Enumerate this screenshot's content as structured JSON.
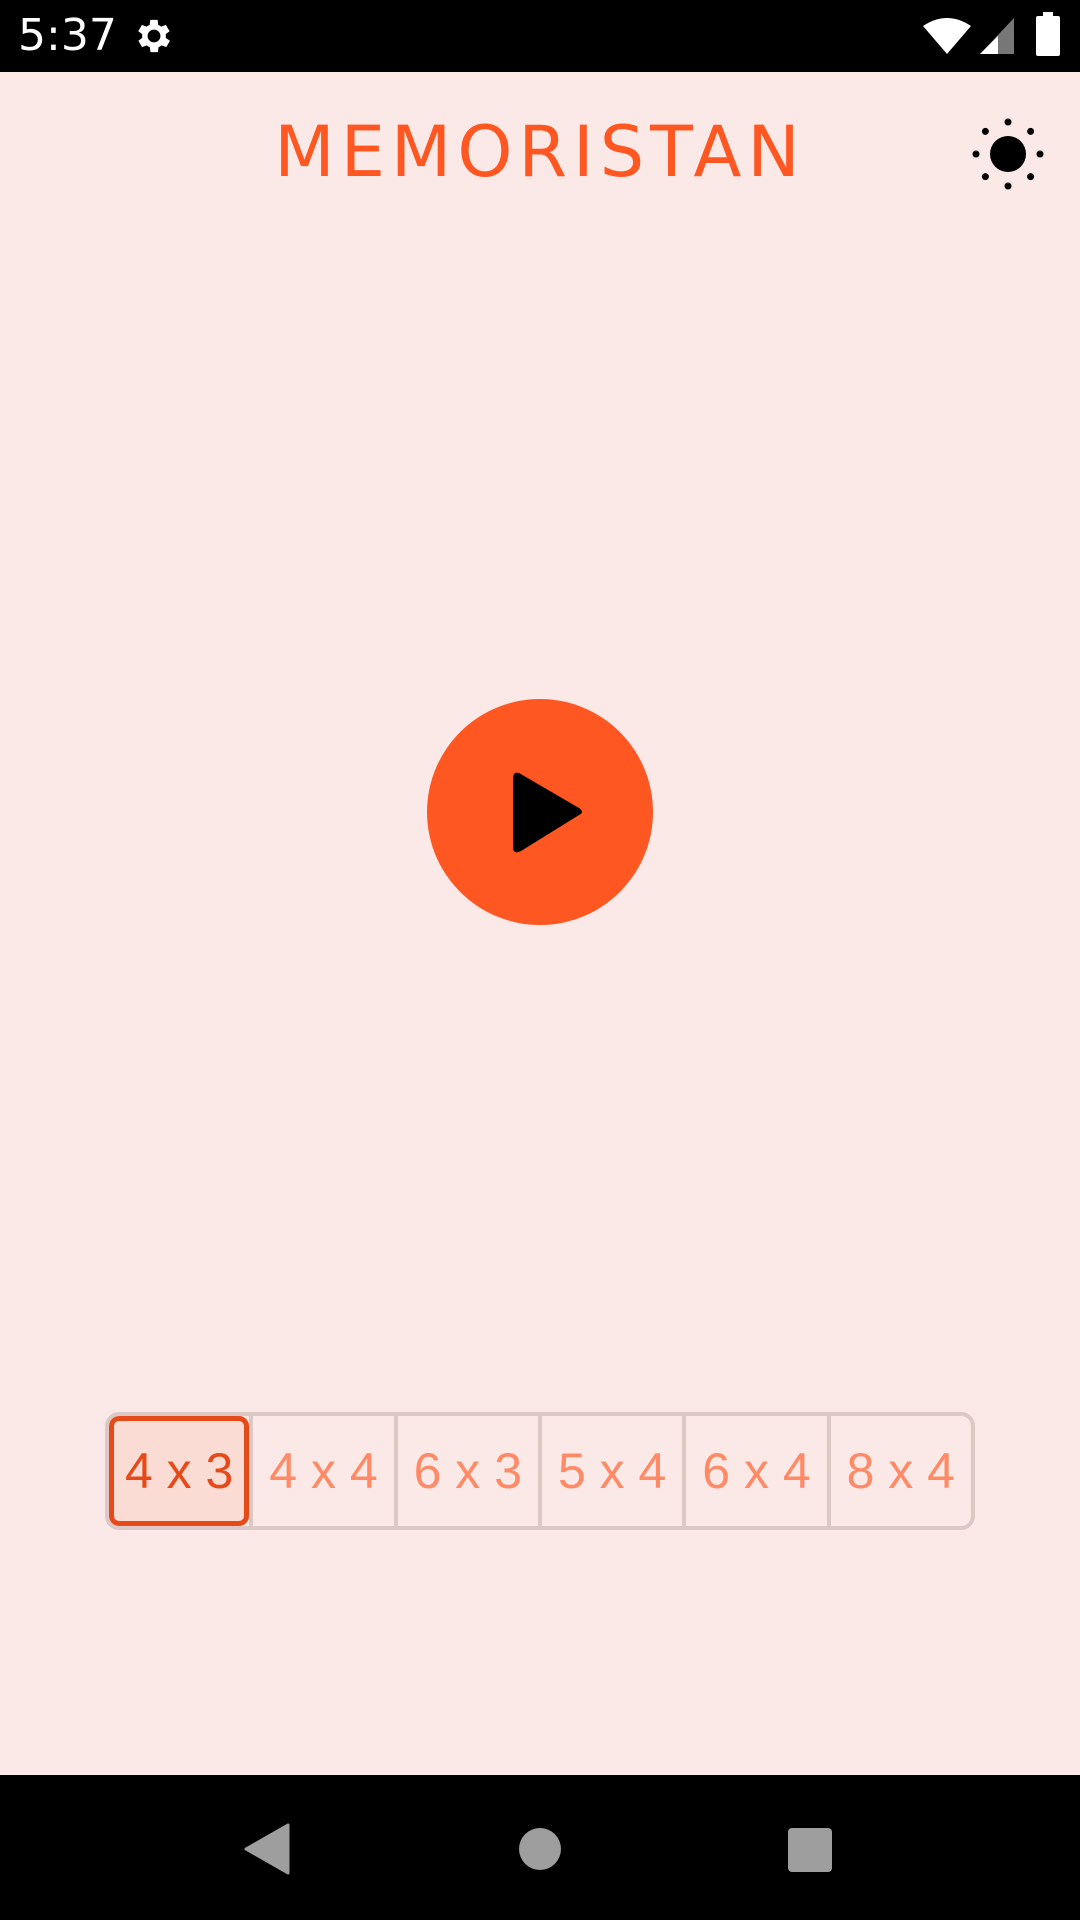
{
  "status_bar": {
    "time": "5:37",
    "icons": [
      "gear-icon",
      "wifi-icon",
      "cell-signal-icon",
      "battery-icon"
    ]
  },
  "app": {
    "title": "MEMORISTAN",
    "theme_icon": "sun-icon",
    "play_icon": "play-icon",
    "accent_color": "#ff5722",
    "background_color": "#fbe9e7"
  },
  "size_selector": {
    "options": [
      {
        "label": "4 x 3",
        "selected": true
      },
      {
        "label": "4 x 4",
        "selected": false
      },
      {
        "label": "6 x 3",
        "selected": false
      },
      {
        "label": "5 x 4",
        "selected": false
      },
      {
        "label": "6 x 4",
        "selected": false
      },
      {
        "label": "8 x 4",
        "selected": false
      }
    ]
  },
  "nav_bar": {
    "icons": [
      "back-icon",
      "home-icon",
      "recents-icon"
    ]
  }
}
